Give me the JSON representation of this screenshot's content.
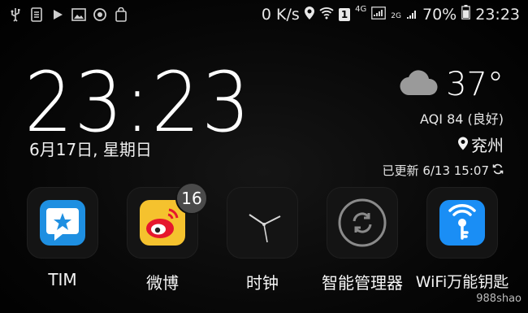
{
  "status_bar": {
    "left_icons": [
      "usb-icon",
      "notes-icon",
      "play-icon",
      "image-icon",
      "sync-icon",
      "bag-icon"
    ],
    "network_speed": "0 K/s",
    "sim_badge": "1",
    "lte_label": "4G",
    "g2_label": "2G",
    "battery": "70%",
    "time": "23:23"
  },
  "clock": {
    "time": "23:23",
    "date": "6月17日, 星期日"
  },
  "weather": {
    "temperature": "37°",
    "aqi": "AQI 84 (良好)",
    "city": "兖州",
    "updated": "已更新 6/13 15:07"
  },
  "apps": [
    {
      "label": "TIM"
    },
    {
      "label": "微博",
      "badge": "16"
    },
    {
      "label": "时钟"
    },
    {
      "label": "智能管理器"
    },
    {
      "label": "WiFi万能钥匙"
    }
  ],
  "watermark": "988shao"
}
